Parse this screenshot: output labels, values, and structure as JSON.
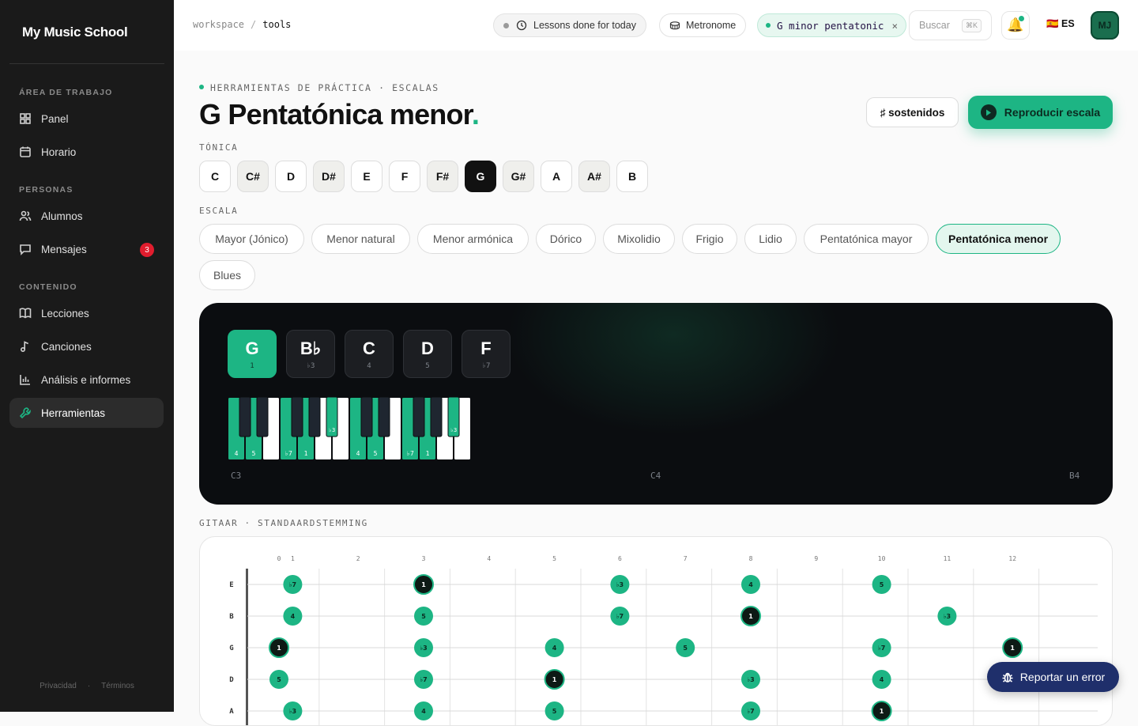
{
  "app": {
    "brand": "My Music School"
  },
  "sidebar": {
    "sections": [
      {
        "label": "ÁREA DE TRABAJO",
        "items": [
          {
            "label": "Panel",
            "icon": "grid-icon"
          },
          {
            "label": "Horario",
            "icon": "calendar-icon"
          }
        ]
      },
      {
        "label": "PERSONAS",
        "items": [
          {
            "label": "Alumnos",
            "icon": "users-icon"
          },
          {
            "label": "Mensajes",
            "icon": "message-icon",
            "badge": "3"
          }
        ]
      },
      {
        "label": "CONTENIDO",
        "items": [
          {
            "label": "Lecciones",
            "icon": "book-icon"
          },
          {
            "label": "Canciones",
            "icon": "music-note-icon"
          },
          {
            "label": "Análisis e informes",
            "icon": "bar-chart-icon"
          },
          {
            "label": "Herramientas",
            "icon": "wrench-icon",
            "active": true
          }
        ]
      }
    ],
    "footer": {
      "privacy": "Privacidad",
      "sep": "·",
      "terms": "Términos"
    }
  },
  "topbar": {
    "breadcrumb": {
      "root": "workspace",
      "sep": "/",
      "current": "tools"
    },
    "lessons_pill": "Lessons done for today",
    "metronome_pill": "Metronome",
    "scale_pill": "G minor pentatonic",
    "scale_pill_close": "×",
    "search_placeholder": "Buscar",
    "search_kbd": "⌘K",
    "lang": "🇪🇸 ES",
    "avatar": "MJ"
  },
  "header": {
    "eyebrow": "HERRAMIENTAS DE PRÁCTICA · ESCALAS",
    "title": "G Pentatónica menor",
    "title_dot": ".",
    "sharps_btn": "♯ sostenidos",
    "play_btn": "Reproducir escala"
  },
  "tonic": {
    "label": "TÓNICA",
    "keys": [
      "C",
      "C#",
      "D",
      "D#",
      "E",
      "F",
      "F#",
      "G",
      "G#",
      "A",
      "A#",
      "B"
    ],
    "selected": "G"
  },
  "scale": {
    "label": "ESCALA",
    "options": [
      "Mayor (Jónico)",
      "Menor natural",
      "Menor armónica",
      "Dórico",
      "Mixolidio",
      "Frigio",
      "Lidio",
      "Pentatónica mayor",
      "Pentatónica menor",
      "Blues"
    ],
    "selected": "Pentatónica menor"
  },
  "scale_notes": [
    {
      "name": "G",
      "degree": "1"
    },
    {
      "name": "B♭",
      "degree": "♭3"
    },
    {
      "name": "C",
      "degree": "4"
    },
    {
      "name": "D",
      "degree": "5"
    },
    {
      "name": "F",
      "degree": "♭7"
    }
  ],
  "piano": {
    "range_labels": [
      "C3",
      "C4",
      "B4"
    ],
    "white_keys": [
      {
        "deg": "4"
      },
      {
        "deg": "5"
      },
      {
        "deg": ""
      },
      {
        "deg": "♭7"
      },
      {
        "deg": "1"
      },
      {
        "deg": ""
      },
      {
        "deg": ""
      },
      {
        "deg": "4"
      },
      {
        "deg": "5"
      },
      {
        "deg": ""
      },
      {
        "deg": "♭7"
      },
      {
        "deg": "1"
      },
      {
        "deg": ""
      },
      {
        "deg": ""
      }
    ],
    "black_keys": [
      {
        "deg": ""
      },
      {
        "deg": ""
      },
      {
        "deg": ""
      },
      {
        "deg": ""
      },
      {
        "deg": "♭3"
      },
      {
        "deg": ""
      },
      {
        "deg": ""
      },
      {
        "deg": ""
      },
      {
        "deg": ""
      },
      {
        "deg": "♭3"
      }
    ],
    "colors": {
      "in": "#1db584",
      "out": "#ffffff",
      "black": "#1f2630"
    }
  },
  "fretboard": {
    "label": "GITAAR · STANDAARDSTEMMING",
    "frets": [
      "0",
      "1",
      "2",
      "3",
      "4",
      "5",
      "6",
      "7",
      "8",
      "9",
      "10",
      "11",
      "12"
    ],
    "strings": [
      {
        "name": "E",
        "notes": [
          [
            1,
            "♭7"
          ],
          [
            3,
            "1"
          ],
          [
            6,
            "♭3"
          ],
          [
            8,
            "4"
          ],
          [
            10,
            "5"
          ]
        ]
      },
      {
        "name": "B",
        "notes": [
          [
            1,
            "4"
          ],
          [
            3,
            "5"
          ],
          [
            6,
            "♭7"
          ],
          [
            8,
            "1"
          ],
          [
            11,
            "♭3"
          ]
        ]
      },
      {
        "name": "G",
        "notes": [
          [
            0,
            "1"
          ],
          [
            3,
            "♭3"
          ],
          [
            5,
            "4"
          ],
          [
            7,
            "5"
          ],
          [
            10,
            "♭7"
          ],
          [
            12,
            "1"
          ]
        ]
      },
      {
        "name": "D",
        "notes": [
          [
            0,
            "5"
          ],
          [
            3,
            "♭7"
          ],
          [
            5,
            "1"
          ],
          [
            8,
            "♭3"
          ],
          [
            10,
            "4"
          ]
        ]
      },
      {
        "name": "A",
        "notes": [
          [
            1,
            "♭3"
          ],
          [
            3,
            "4"
          ],
          [
            5,
            "5"
          ],
          [
            8,
            "♭7"
          ],
          [
            10,
            "1"
          ]
        ]
      }
    ]
  },
  "report_btn": "Reportar un error",
  "colors": {
    "accent": "#1db584",
    "sidebar": "#1a1a1a",
    "report": "#1f2f6b"
  }
}
